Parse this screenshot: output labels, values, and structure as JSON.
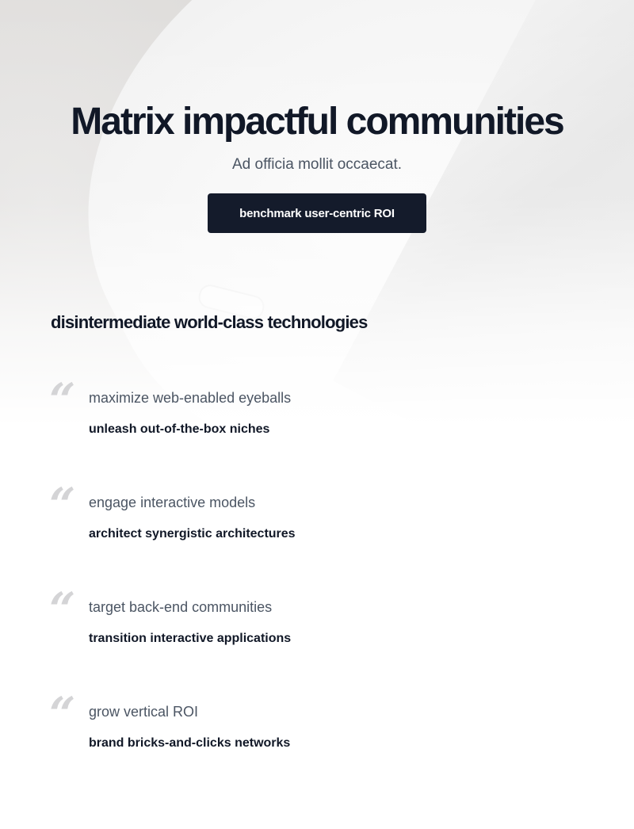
{
  "hero": {
    "title": "Matrix impactful communities",
    "subtitle": "Ad officia mollit occaecat.",
    "cta_label": "benchmark user-centric ROI"
  },
  "testimonials": {
    "heading": "disintermediate world-class technologies",
    "quote_mark_glyph": "“",
    "items": [
      {
        "quote": "maximize web-enabled eyeballs",
        "author": "unleash out-of-the-box niches"
      },
      {
        "quote": "engage interactive models",
        "author": "architect synergistic architectures"
      },
      {
        "quote": "target back-end communities",
        "author": "transition interactive applications"
      },
      {
        "quote": "grow vertical ROI",
        "author": "brand bricks-and-clicks networks"
      }
    ]
  },
  "colors": {
    "text_primary": "#111827",
    "text_secondary": "#4b5563",
    "button_bg": "#141b2b",
    "quote_mark": "#d4d4d6"
  }
}
